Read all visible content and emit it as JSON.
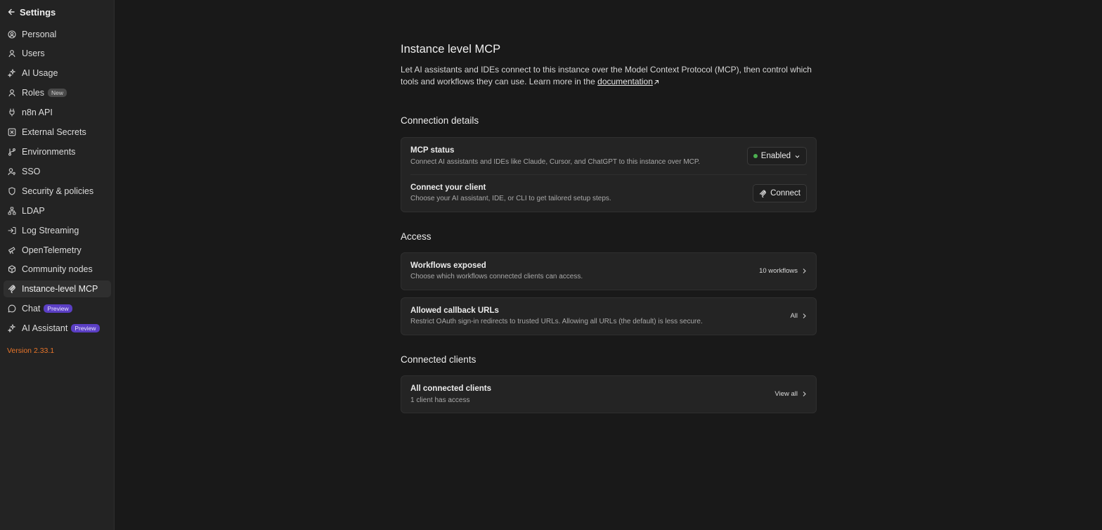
{
  "sidebar": {
    "back_label": "Settings",
    "items": [
      {
        "label": "Personal",
        "icon": "user-circle-icon"
      },
      {
        "label": "Users",
        "icon": "user-icon"
      },
      {
        "label": "AI Usage",
        "icon": "sparkles-icon"
      },
      {
        "label": "Roles",
        "icon": "user-icon",
        "badge": "New"
      },
      {
        "label": "n8n API",
        "icon": "plug-icon"
      },
      {
        "label": "External Secrets",
        "icon": "secrets-box-icon"
      },
      {
        "label": "Environments",
        "icon": "git-branch-icon"
      },
      {
        "label": "SSO",
        "icon": "users-key-icon"
      },
      {
        "label": "Security & policies",
        "icon": "shield-icon"
      },
      {
        "label": "LDAP",
        "icon": "network-icon"
      },
      {
        "label": "Log Streaming",
        "icon": "log-in-icon"
      },
      {
        "label": "OpenTelemetry",
        "icon": "telescope-icon"
      },
      {
        "label": "Community nodes",
        "icon": "box-icon"
      },
      {
        "label": "Instance-level MCP",
        "icon": "mcp-icon",
        "active": true
      },
      {
        "label": "Chat",
        "icon": "chat-bubble-icon",
        "badge": "Preview"
      },
      {
        "label": "AI Assistant",
        "icon": "sparkles-icon",
        "badge": "Preview"
      }
    ],
    "version": "Version 2.33.1"
  },
  "main": {
    "title": "Instance level MCP",
    "description_text": "Let AI assistants and IDEs connect to this instance over the Model Context Protocol (MCP), then control which tools and workflows they can use. Learn more in the ",
    "description_link": "documentation",
    "connection_details": {
      "title": "Connection details",
      "mcp_status": {
        "title": "MCP status",
        "desc": "Connect AI assistants and IDEs like Claude, Cursor, and ChatGPT to this instance over MCP.",
        "value": "Enabled"
      },
      "connect_client": {
        "title": "Connect your client",
        "desc": "Choose your AI assistant, IDE, or CLI to get tailored setup steps.",
        "button": "Connect"
      }
    },
    "access": {
      "title": "Access",
      "workflows": {
        "title": "Workflows exposed",
        "desc": "Choose which workflows connected clients can access.",
        "value": "10 workflows"
      },
      "callbacks": {
        "title": "Allowed callback URLs",
        "desc": "Restrict OAuth sign-in redirects to trusted URLs. Allowing all URLs (the default) is less secure.",
        "value": "All"
      }
    },
    "connected_clients": {
      "title": "Connected clients",
      "all": {
        "title": "All connected clients",
        "desc": "1 client has access",
        "value": "View all"
      }
    }
  },
  "colors": {
    "background": "#191919",
    "sidebar": "#232323",
    "card": "#242424",
    "version": "#e8752a",
    "status_dot": "#4caf50",
    "preview_badge": "#5b3fc4"
  }
}
